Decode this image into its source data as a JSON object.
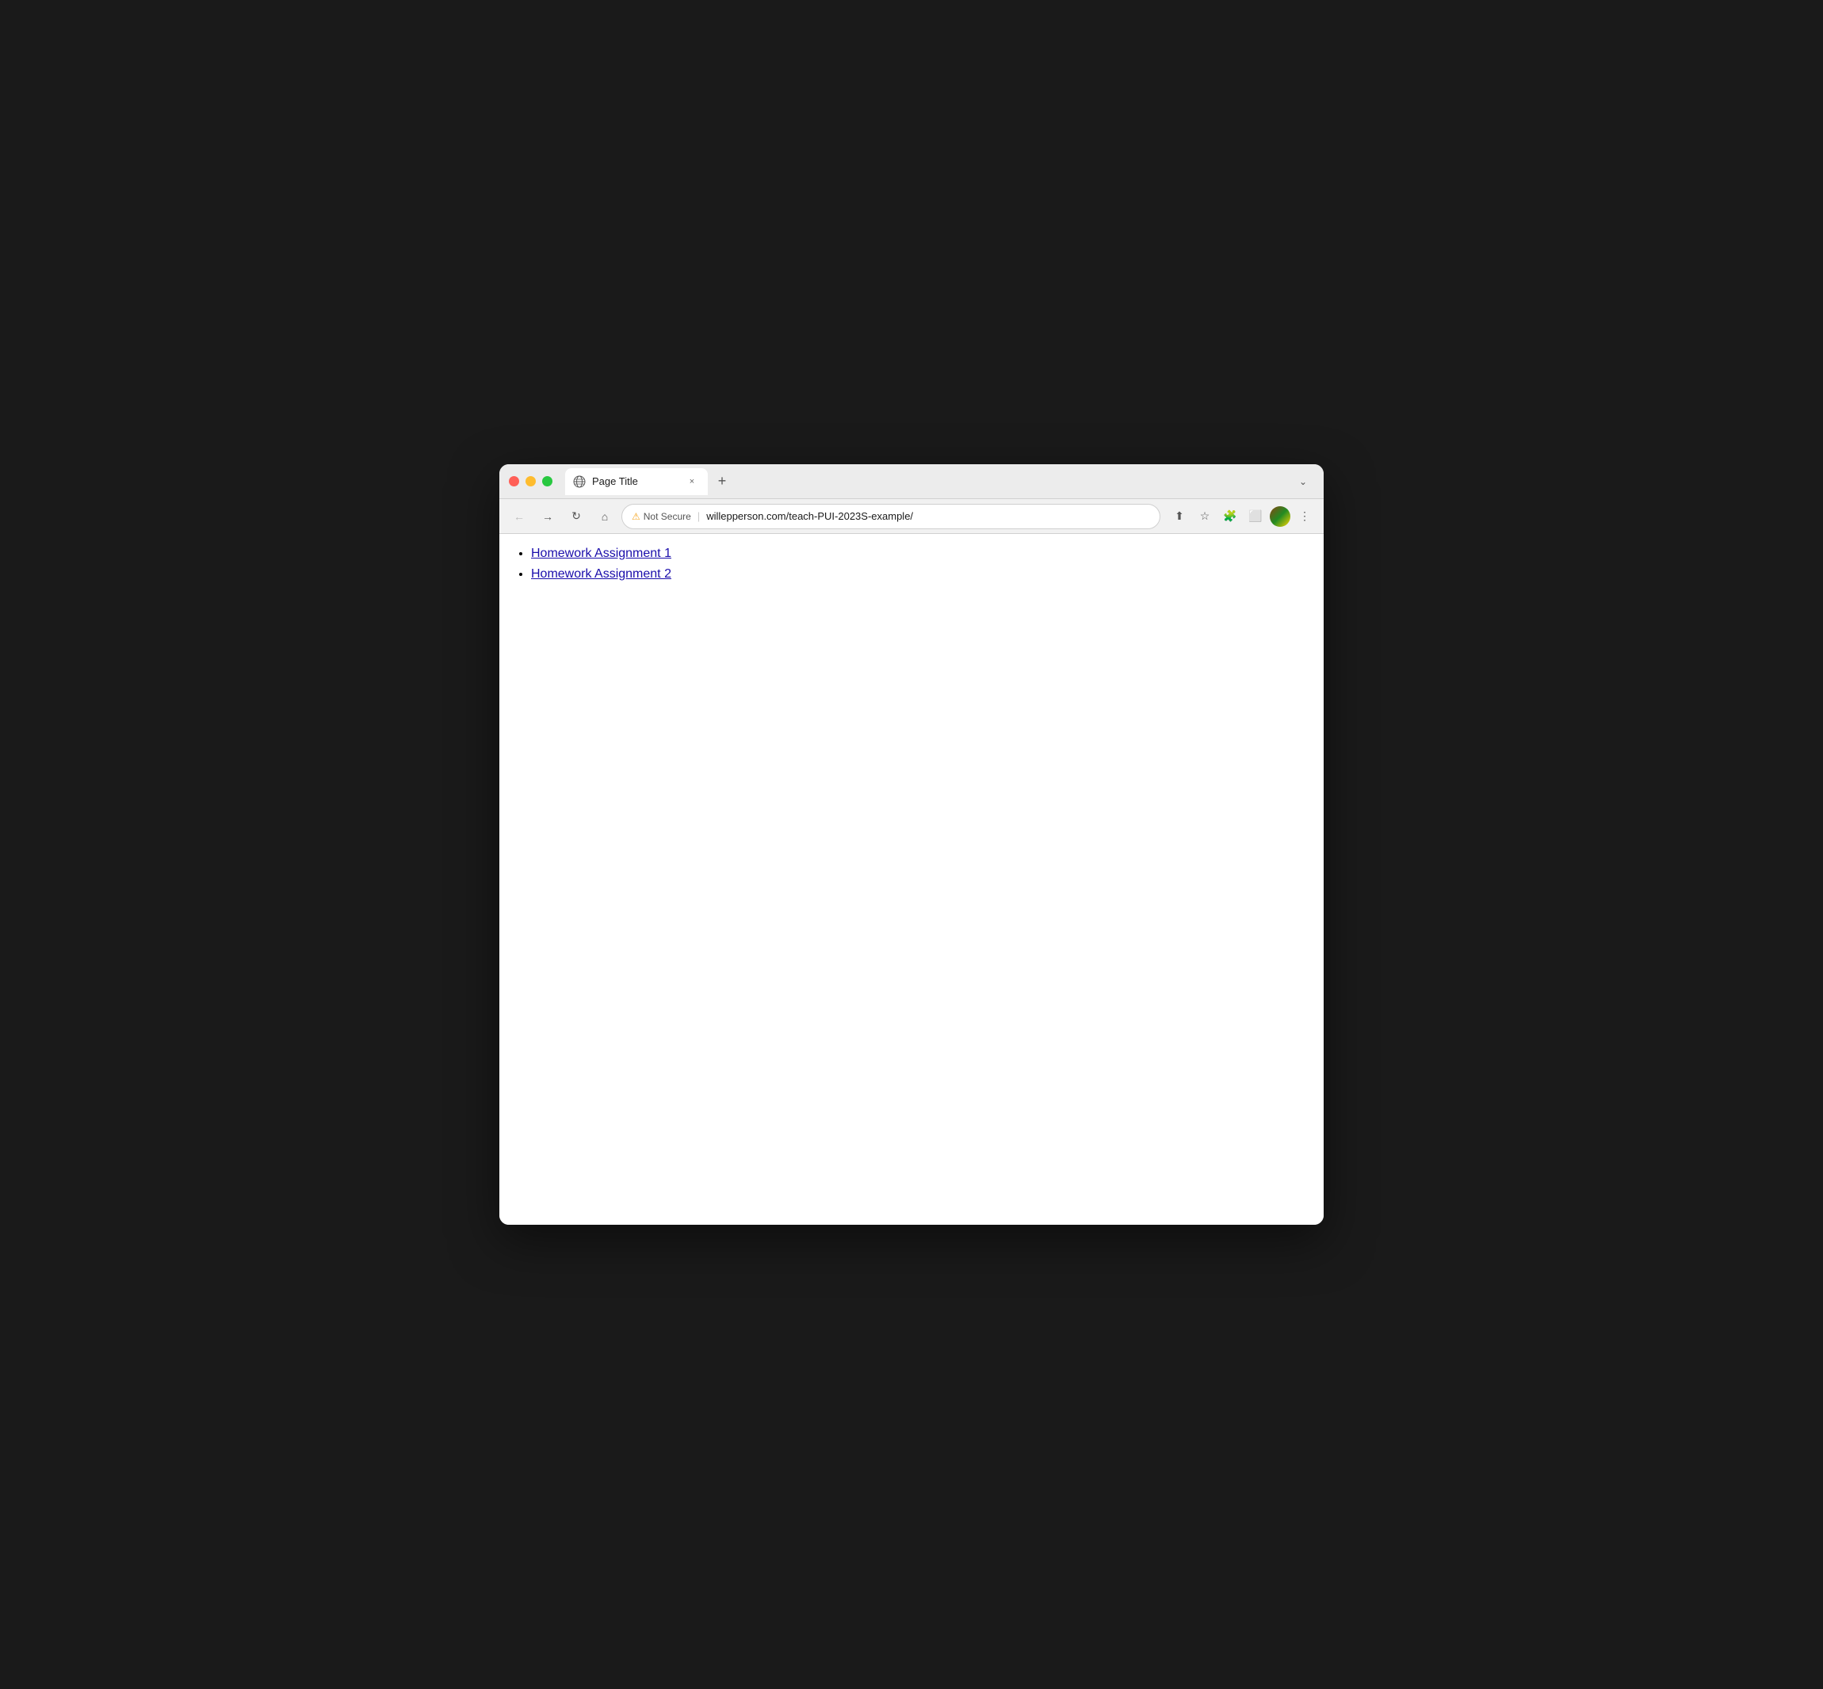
{
  "window": {
    "title": "Page Title"
  },
  "controls": {
    "close_label": "",
    "minimize_label": "",
    "maximize_label": ""
  },
  "tab": {
    "title": "Page Title",
    "close_label": "×",
    "new_tab_label": "+",
    "expand_label": "⌄"
  },
  "nav": {
    "back_label": "←",
    "forward_label": "→",
    "refresh_label": "↻",
    "home_label": "⌂",
    "not_secure_text": "Not Secure",
    "url": "willepperson.com/teach-PUI-2023S-example/",
    "share_label": "⬆",
    "bookmark_label": "☆",
    "extensions_label": "🧩",
    "split_label": "⬜",
    "more_label": "⋮"
  },
  "content": {
    "links": [
      {
        "text": "Homework Assignment 1",
        "href": "#"
      },
      {
        "text": "Homework Assignment 2",
        "href": "#"
      }
    ]
  }
}
